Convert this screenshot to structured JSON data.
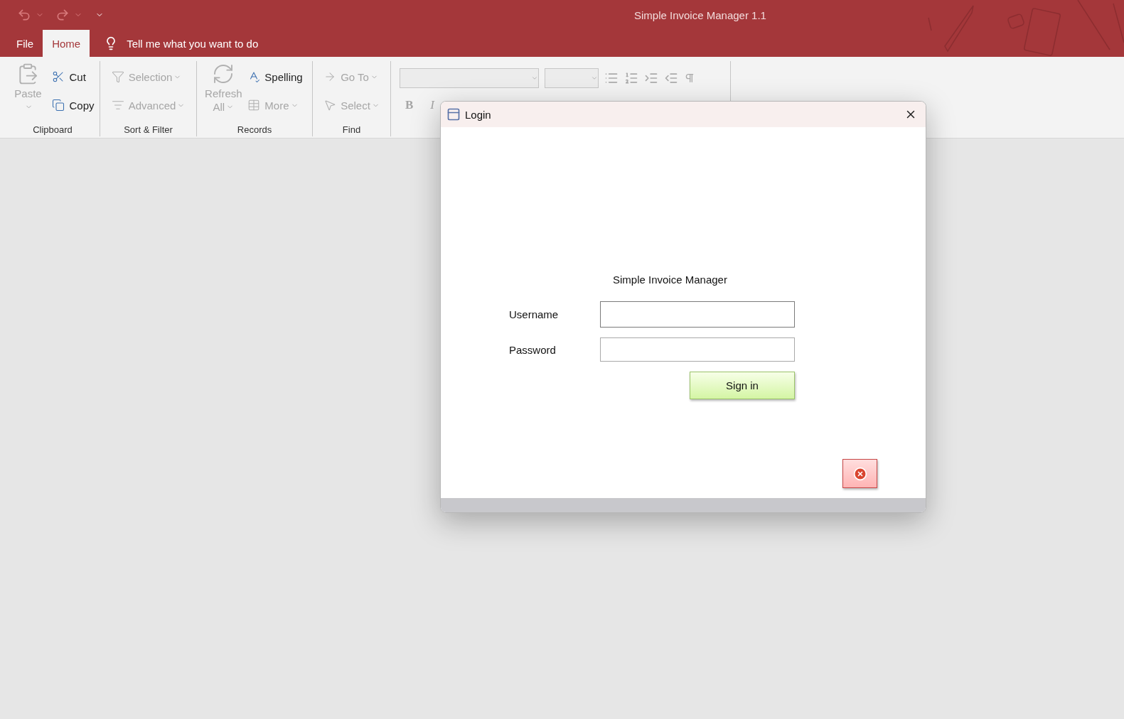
{
  "window": {
    "title": "Simple Invoice Manager 1.1"
  },
  "tabs": [
    {
      "label": "File",
      "selected": false
    },
    {
      "label": "Home",
      "selected": true
    }
  ],
  "tell_me": {
    "placeholder": "Tell me what you want to do"
  },
  "ribbon": {
    "groups": [
      {
        "name": "Clipboard",
        "commands": [
          {
            "label": "Paste",
            "kind": "large",
            "disabled": true,
            "dropdown": true
          },
          {
            "label": "Cut",
            "kind": "small",
            "disabled": false,
            "dropdown": false
          },
          {
            "label": "Copy",
            "kind": "small",
            "disabled": false,
            "dropdown": false
          }
        ]
      },
      {
        "name": "Sort & Filter",
        "commands": [
          {
            "label": "Selection",
            "kind": "small",
            "disabled": true,
            "dropdown": true
          },
          {
            "label": "Advanced",
            "kind": "small",
            "disabled": true,
            "dropdown": true
          }
        ]
      },
      {
        "name": "Records",
        "commands": [
          {
            "label": "Refresh All",
            "kind": "large",
            "disabled": true,
            "dropdown": true
          },
          {
            "label": "Spelling",
            "kind": "small",
            "disabled": false,
            "dropdown": false
          },
          {
            "label": "More",
            "kind": "small",
            "disabled": true,
            "dropdown": true
          }
        ]
      },
      {
        "name": "Find",
        "commands": [
          {
            "label": "Go To",
            "kind": "small",
            "disabled": true,
            "dropdown": true
          },
          {
            "label": "Select",
            "kind": "small",
            "disabled": true,
            "dropdown": true
          }
        ]
      }
    ],
    "format": {
      "bold": "B",
      "italic": "I"
    }
  },
  "dialog": {
    "title": "Login",
    "heading": "Simple Invoice Manager",
    "fields": [
      {
        "label": "Username",
        "focused": true
      },
      {
        "label": "Password",
        "focused": false
      }
    ],
    "submit": "Sign in"
  }
}
